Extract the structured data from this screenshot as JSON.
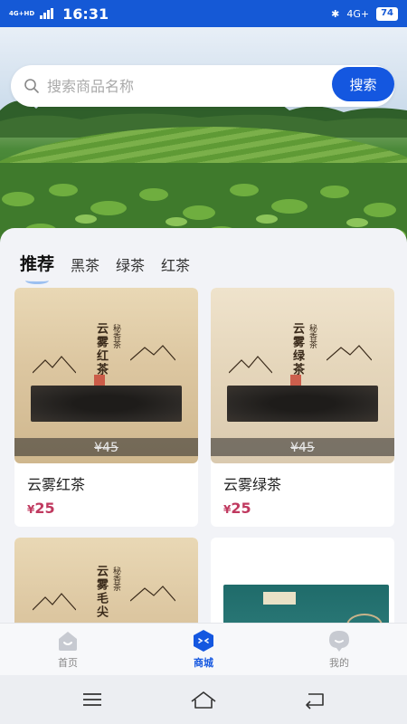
{
  "status_bar": {
    "network": "4G+HD",
    "time": "16:31",
    "network_right": "4G+",
    "battery": "74"
  },
  "search": {
    "placeholder": "搜索商品名称",
    "button_label": "搜索"
  },
  "tabs": [
    {
      "label": "推荐",
      "active": true
    },
    {
      "label": "黑茶",
      "active": false
    },
    {
      "label": "绿茶",
      "active": false
    },
    {
      "label": "红茶",
      "active": false
    }
  ],
  "products": [
    {
      "name": "云雾红茶",
      "currency": "¥",
      "price": "25",
      "old_price": "¥45",
      "bag_title": "云雾红茶",
      "bag_sub": "秘香茶"
    },
    {
      "name": "云雾绿茶",
      "currency": "¥",
      "price": "25",
      "old_price": "¥45",
      "bag_title": "云雾绿茶",
      "bag_sub": "秘香茶"
    },
    {
      "bag_title": "云雾毛尖",
      "bag_sub": "秘香茶"
    },
    {}
  ],
  "bottom_nav": [
    {
      "label": "首页",
      "icon": "home-icon",
      "active": false
    },
    {
      "label": "商城",
      "icon": "mall-icon",
      "active": true
    },
    {
      "label": "我的",
      "icon": "profile-icon",
      "active": false
    }
  ],
  "colors": {
    "primary": "#1457e0",
    "status_bar": "#1559d6",
    "price": "#c0395f"
  }
}
